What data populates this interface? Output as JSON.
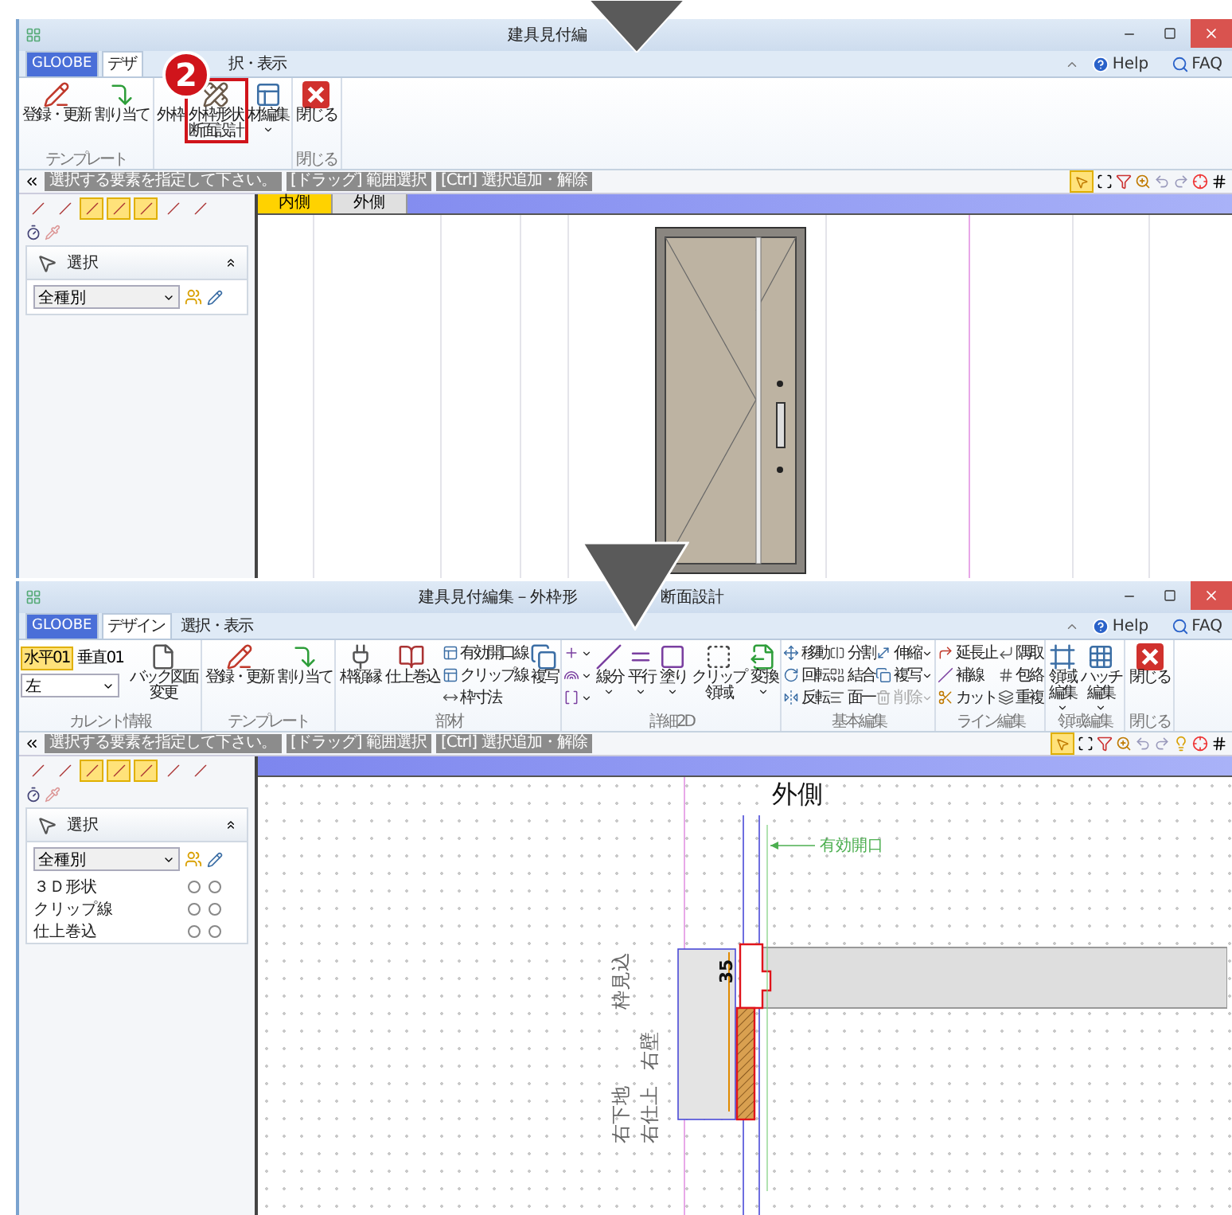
{
  "screens": [
    {
      "title_parts": [
        "建具見付編"
      ],
      "tabs": [
        {
          "label": "GLOOBE",
          "kind": "app",
          "selected": false
        },
        {
          "label": "デザ",
          "kind": "tab",
          "selected": true
        },
        {
          "label": "択・表示",
          "kind": "tab",
          "selected": false
        }
      ],
      "help": "Help",
      "faq": "FAQ",
      "ribbon": [
        {
          "label": "テンプレート",
          "items": [
            {
              "kind": "large",
              "label": "登録・更新"
            },
            {
              "kind": "large",
              "label": "割り当て"
            }
          ]
        },
        {
          "items": [
            {
              "kind": "large",
              "label": "外枠"
            },
            {
              "kind": "large",
              "lines": [
                "外枠形状",
                "断面設計"
              ],
              "highlighted": true
            },
            {
              "kind": "large",
              "label": "材編集",
              "dropdown": true
            }
          ]
        },
        {
          "label": "閉じる",
          "items": [
            {
              "kind": "large",
              "label": "閉じる"
            }
          ]
        }
      ],
      "hints": [
        "選択する要素を指定して下さい。",
        "[ドラッグ] 範囲選択",
        "[Ctrl] 選択追加・解除"
      ],
      "snap_tools": [
        {
          "on": false
        },
        {
          "on": false
        },
        {
          "on": true
        },
        {
          "on": true
        },
        {
          "on": true
        },
        {
          "on": false
        },
        {
          "on": false
        }
      ],
      "left": {
        "header": "選択",
        "filter": "全種別"
      },
      "view_tabs": [
        {
          "label": "内側",
          "selected": true
        },
        {
          "label": "外側",
          "selected": false
        }
      ],
      "canvas": {
        "kind": "elevation"
      }
    },
    {
      "title_parts": [
        "建具見付編集－外枠形",
        "断面設計"
      ],
      "tabs": [
        {
          "label": "GLOOBE",
          "kind": "app",
          "selected": false
        },
        {
          "label": "デザイン",
          "kind": "tab",
          "selected": true
        },
        {
          "label": "選択・表示",
          "kind": "tab",
          "selected": false
        }
      ],
      "help": "Help",
      "faq": "FAQ",
      "ribbon": [
        {
          "label": "カレント情報",
          "items": [
            {
              "kind": "current",
              "chips": [
                {
                  "label": "水平01",
                  "selected": true
                },
                {
                  "label": "垂直01",
                  "selected": false
                }
              ],
              "select": "左"
            },
            {
              "kind": "large",
              "lines": [
                "バック図面",
                "変更"
              ]
            }
          ]
        },
        {
          "label": "テンプレート",
          "items": [
            {
              "kind": "large",
              "label": "登録・更新"
            },
            {
              "kind": "large",
              "label": "割り当て"
            }
          ]
        },
        {
          "label": "部材",
          "items": [
            {
              "kind": "large",
              "label": "枠額縁"
            },
            {
              "kind": "large",
              "label": "仕上巻込"
            },
            {
              "kind": "stack",
              "rows": [
                {
                  "label": "有効開口線"
                },
                {
                  "label": "クリップ線"
                },
                {
                  "label": "枠寸法"
                }
              ]
            },
            {
              "kind": "large",
              "label": "複写"
            }
          ]
        },
        {
          "label": "詳細2D",
          "items": [
            {
              "kind": "stack",
              "rows": [
                {
                  "dropdown": true
                },
                {
                  "dropdown": true
                },
                {
                  "dropdown": true
                }
              ]
            },
            {
              "kind": "large",
              "label": "線分",
              "dropdown": true
            },
            {
              "kind": "large",
              "label": "平行",
              "dropdown": true
            },
            {
              "kind": "large",
              "label": "塗り",
              "dropdown": true
            },
            {
              "kind": "large",
              "lines": [
                "クリップ",
                "領域"
              ]
            },
            {
              "kind": "large",
              "label": "変換",
              "dropdown": true
            }
          ]
        },
        {
          "label": "基本編集",
          "items": [
            {
              "kind": "stack",
              "rows": [
                {
                  "label": "移動"
                },
                {
                  "label": "回転"
                },
                {
                  "label": "反転"
                }
              ]
            },
            {
              "kind": "stack",
              "rows": [
                {
                  "label": "分割"
                },
                {
                  "label": "結合"
                },
                {
                  "label": "面一"
                }
              ]
            },
            {
              "kind": "stack",
              "rows": [
                {
                  "label": "伸縮",
                  "dropdown": true
                },
                {
                  "label": "複写",
                  "dropdown": true
                },
                {
                  "label": "削除",
                  "dropdown": true,
                  "disabled": true
                }
              ]
            }
          ]
        },
        {
          "label": "ライン編集",
          "items": [
            {
              "kind": "stack",
              "rows": [
                {
                  "label": "延長止"
                },
                {
                  "label": "補線"
                },
                {
                  "label": "カット"
                }
              ]
            },
            {
              "kind": "stack",
              "rows": [
                {
                  "label": "隅取"
                },
                {
                  "label": "包絡"
                },
                {
                  "label": "重複"
                }
              ]
            }
          ]
        },
        {
          "label": "領域編集",
          "items": [
            {
              "kind": "large",
              "lines": [
                "領域",
                "編集"
              ],
              "dropdown": true
            },
            {
              "kind": "large",
              "lines": [
                "ハッチ",
                "編集"
              ],
              "dropdown": true
            }
          ]
        },
        {
          "label": "閉じる",
          "items": [
            {
              "kind": "large",
              "label": "閉じる"
            }
          ]
        }
      ],
      "hints": [
        "選択する要素を指定して下さい。",
        "[ドラッグ] 範囲選択",
        "[Ctrl] 選択追加・解除"
      ],
      "snap_tools": [
        {
          "on": false
        },
        {
          "on": false
        },
        {
          "on": true
        },
        {
          "on": true
        },
        {
          "on": true
        },
        {
          "on": false
        },
        {
          "on": false
        }
      ],
      "left": {
        "header": "選択",
        "filter": "全種別",
        "rows": [
          "３Ｄ形状",
          "クリップ線",
          "仕上巻込"
        ]
      },
      "canvas": {
        "kind": "section",
        "side_label": "外側",
        "opening_label": "有効開口",
        "dimension": "35",
        "wall_labels": [
          "枠見込",
          "右壁",
          "右下地",
          "右仕上"
        ]
      }
    }
  ],
  "badge": "2"
}
